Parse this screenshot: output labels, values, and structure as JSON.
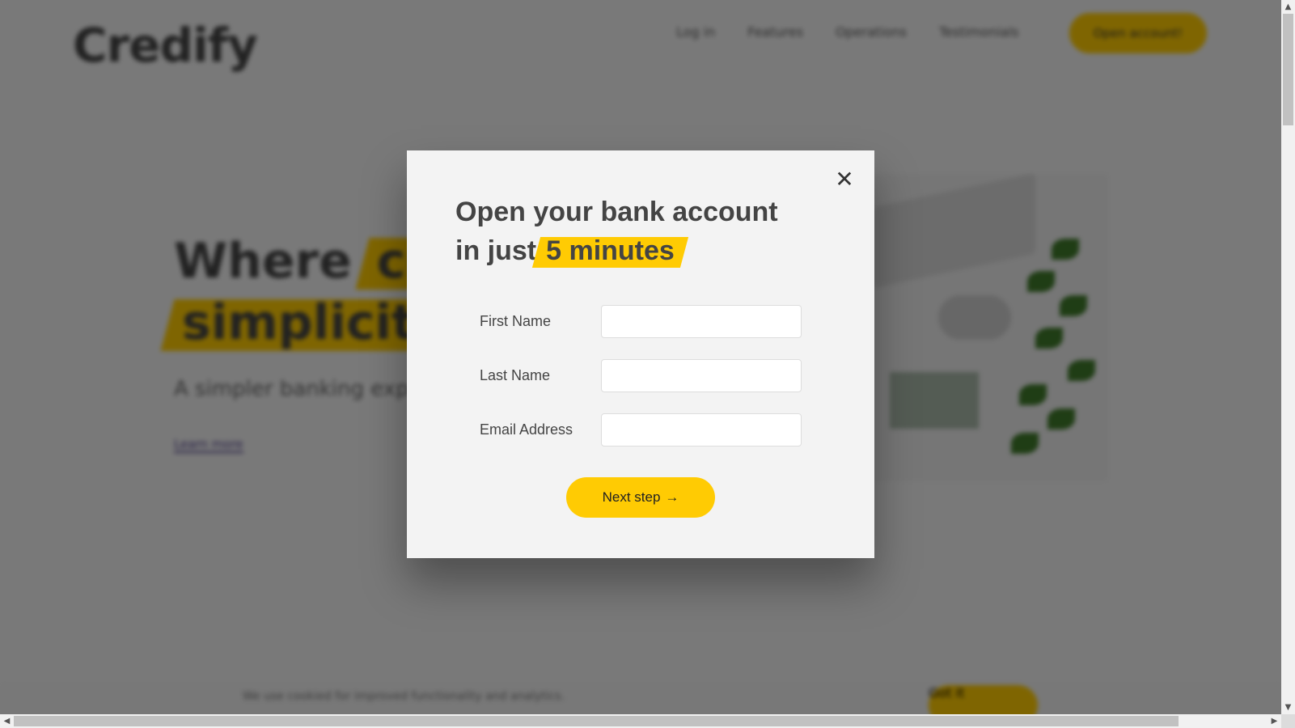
{
  "background_page": {
    "logo": "Credify",
    "nav": [
      "Log in",
      "Features",
      "Operations",
      "Testimonials"
    ],
    "nav_cta": "Open account!",
    "hero_title_line1_plain": "Where",
    "hero_title_line1_highlight": "cre",
    "hero_title_line2_highlight": "simplicity",
    "hero_subtitle": "A simpler banking expe",
    "hero_link": "Learn more",
    "cookie_text": "We use cookied for improved functionality and analytics.",
    "cookie_button": "Got it"
  },
  "modal": {
    "title_line1": "Open your bank account",
    "title_line2_plain": "in just",
    "title_highlight": "5 minutes",
    "close_glyph": "✕",
    "fields": [
      {
        "label": "First Name",
        "value": ""
      },
      {
        "label": "Last Name",
        "value": ""
      },
      {
        "label": "Email Address",
        "value": ""
      }
    ],
    "submit_label": "Next step",
    "submit_arrow": "→"
  },
  "colors": {
    "accent": "#ffcb03",
    "text": "#444444",
    "modal_bg": "#f3f3f3",
    "overlay": "rgba(0,0,0,0.5)"
  },
  "icons": {
    "close": "close-icon",
    "arrow": "arrow-right-icon"
  }
}
